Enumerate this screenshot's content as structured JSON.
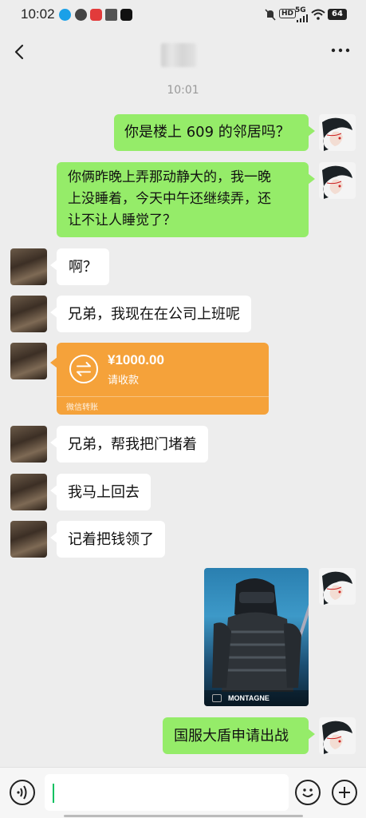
{
  "status_bar": {
    "time": "10:02",
    "battery": "64",
    "network": "5G",
    "hd": "HD"
  },
  "header": {
    "back_icon": "back-arrow-icon",
    "more_icon": "more-icon"
  },
  "timestamp": "10:01",
  "messages": [
    {
      "from": "me",
      "type": "text",
      "text": "你是楼上 609 的邻居吗？"
    },
    {
      "from": "me",
      "type": "text",
      "lines": [
        "你俩昨晚上弄那动静大的，我一晚",
        "上没睡着，今天中午还继续弄，还",
        "让不让人睡觉了？"
      ]
    },
    {
      "from": "other",
      "type": "text",
      "text": "啊？"
    },
    {
      "from": "other",
      "type": "text",
      "text": "兄弟，我现在在公司上班呢"
    },
    {
      "from": "other",
      "type": "transfer",
      "amount": "¥1000.00",
      "note": "请收款",
      "footer": "微信转账"
    },
    {
      "from": "other",
      "type": "text",
      "text": "兄弟，帮我把门堵着"
    },
    {
      "from": "other",
      "type": "text",
      "text": "我马上回去"
    },
    {
      "from": "other",
      "type": "text",
      "text": "记着把钱领了"
    },
    {
      "from": "me",
      "type": "image",
      "caption": "MONTAGNE"
    },
    {
      "from": "me",
      "type": "text",
      "text": "国服大盾申请出战"
    }
  ],
  "colors": {
    "my_bubble": "#95ec69",
    "other_bubble": "#ffffff",
    "transfer": "#f5a23a",
    "background": "#ededed"
  },
  "input_bar": {
    "voice_icon": "voice-icon",
    "emoji_icon": "emoji-icon",
    "plus_icon": "plus-icon"
  }
}
